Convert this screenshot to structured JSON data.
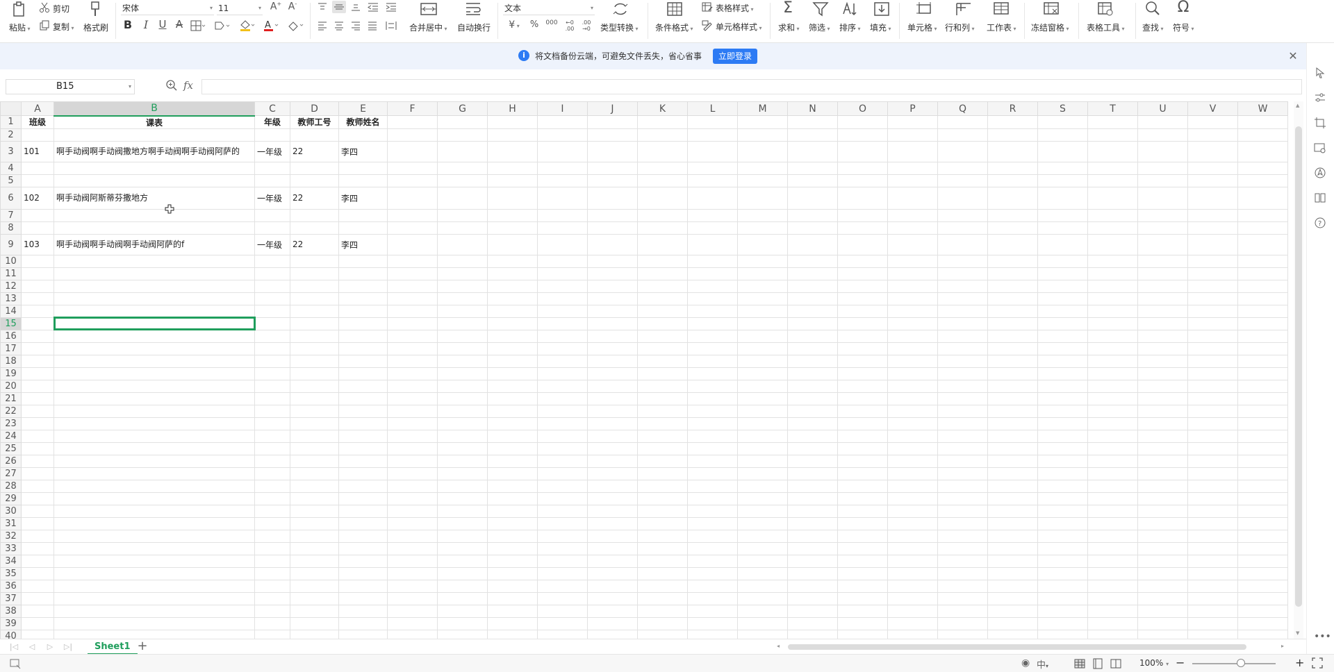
{
  "ribbon": {
    "paste": "粘贴",
    "cut": "剪切",
    "copy": "复制",
    "format_painter": "格式刷",
    "font_name": "宋体",
    "font_size": "11",
    "merge_center": "合并居中",
    "wrap_text": "自动换行",
    "number_format": "文本",
    "type_convert": "类型转换",
    "cond_format": "条件格式",
    "table_style": "表格样式",
    "cell_style": "单元格样式",
    "sum": "求和",
    "filter": "筛选",
    "sort": "排序",
    "fill": "填充",
    "cell": "单元格",
    "row_col": "行和列",
    "worksheet": "工作表",
    "freeze": "冻结窗格",
    "table_tools": "表格工具",
    "find": "查找",
    "symbol": "符号"
  },
  "notification": {
    "text": "将文档备份云端，可避免文件丢失，省心省事",
    "button": "立即登录"
  },
  "formula_bar": {
    "cell_ref": "B15",
    "fx": "fx",
    "value": ""
  },
  "grid": {
    "columns": [
      "A",
      "B",
      "C",
      "D",
      "E",
      "F",
      "G",
      "H",
      "I",
      "J",
      "K",
      "L",
      "M",
      "N",
      "O",
      "P",
      "Q",
      "R",
      "S",
      "T",
      "U",
      "V",
      "W"
    ],
    "selected_column": "B",
    "selected_row": 15,
    "row_count": 42,
    "header": {
      "A": "班级",
      "B": "课表",
      "C": "年级",
      "D": "教师工号",
      "E": "教师姓名"
    },
    "records": [
      {
        "A": "101",
        "B": "啊手动阀啊手动阀撒地方啊手动阀啊手动阀阿萨的",
        "C": "一年级",
        "D": "22",
        "E": "李四"
      },
      {
        "A": "102",
        "B": "啊手动阀阿斯蒂芬撒地方",
        "C": "一年级",
        "D": "22",
        "E": "李四"
      },
      {
        "A": "103",
        "B": "啊手动阀啊手动阀啊手动阀阿萨的f",
        "C": "一年级",
        "D": "22",
        "E": "李四"
      }
    ]
  },
  "sheets": {
    "active": "Sheet1"
  },
  "status": {
    "zoom": "100%"
  },
  "colors": {
    "accent": "#1f9e5c",
    "button_blue": "#2d7bf4",
    "notif_bg": "#eef3fc"
  }
}
